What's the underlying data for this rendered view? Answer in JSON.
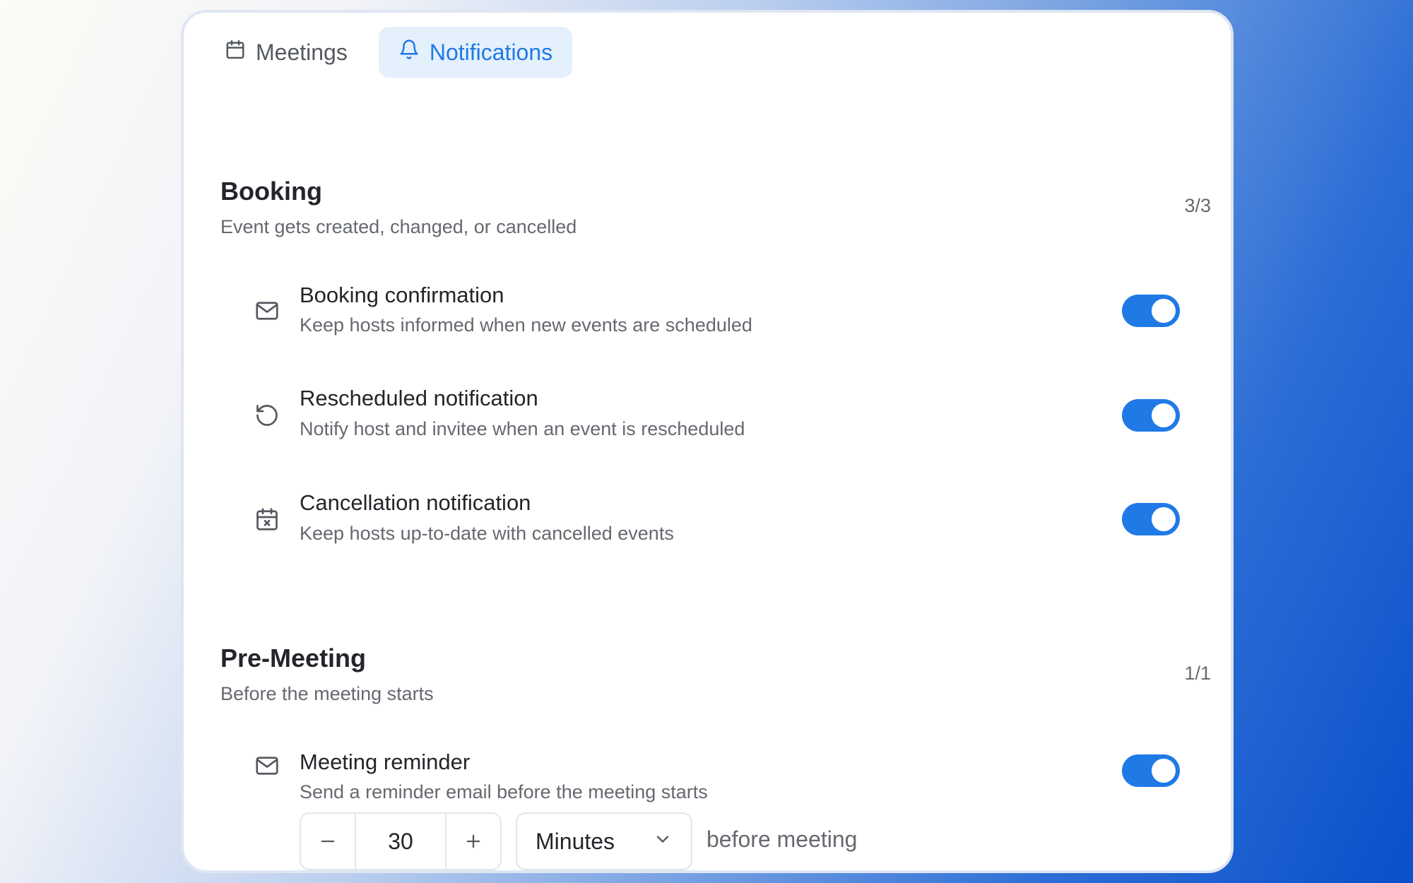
{
  "tabs": [
    {
      "label": "Meetings",
      "icon": "calendar-icon"
    },
    {
      "label": "Notifications",
      "icon": "bell-icon"
    }
  ],
  "accent_color": "#1f7ae6",
  "sections": [
    {
      "title": "Booking",
      "subtitle": "Event gets created, changed, or cancelled",
      "count": "3/3",
      "items": [
        {
          "title": "Booking confirmation",
          "description": "Keep hosts informed when new events are scheduled",
          "icon": "mail-icon",
          "enabled": true
        },
        {
          "title": "Rescheduled notification",
          "description": "Notify host and invitee when an event is rescheduled",
          "icon": "rotate-ccw-icon",
          "enabled": true
        },
        {
          "title": "Cancellation notification",
          "description": "Keep hosts up-to-date with cancelled events",
          "icon": "calendar-x-icon",
          "enabled": true
        }
      ]
    },
    {
      "title": "Pre-Meeting",
      "subtitle": "Before the meeting starts",
      "count": "1/1",
      "items": [
        {
          "title": "Meeting reminder",
          "description": "Send a reminder email before the meeting starts",
          "icon": "mail-icon",
          "enabled": true
        }
      ]
    }
  ],
  "reminder": {
    "value": "30",
    "unit": "Minutes",
    "suffix": "before meeting"
  }
}
